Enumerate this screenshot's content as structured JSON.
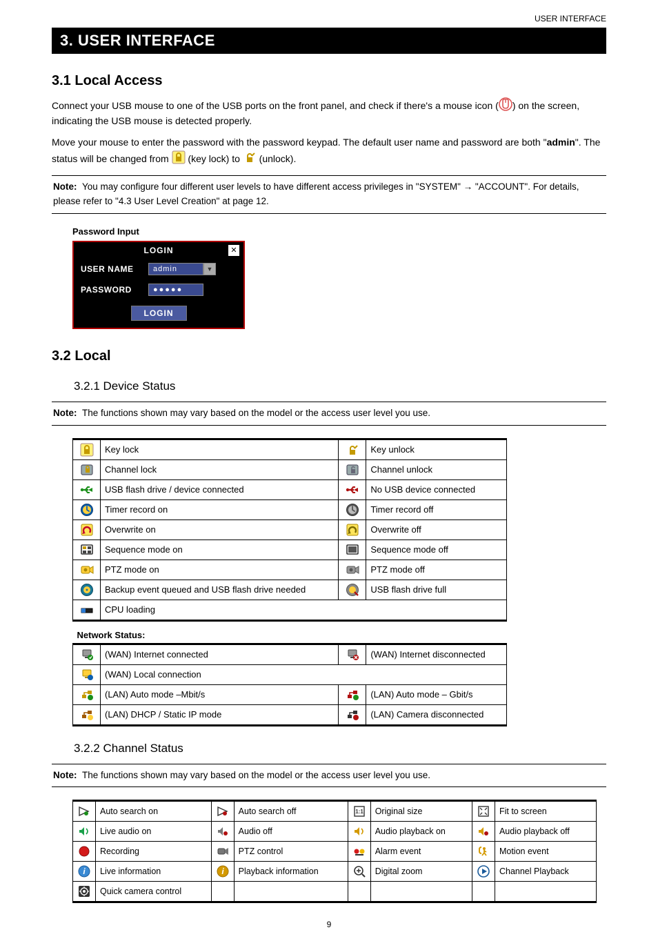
{
  "header_right": "USER INTERFACE",
  "chapter_title": "3. USER INTERFACE",
  "s31": {
    "title": "3.1 Local Access",
    "p1a": "Connect your USB mouse to one of the USB ports on the front panel, and check if there's a mouse icon (",
    "p1b": ") on the screen, indicating the USB mouse is detected properly.",
    "p2a": "Move your mouse to enter the password with the password keypad. The default user name and password are both \"",
    "p2_admin": "admin",
    "p2b": "\". The status will be changed from ",
    "p2c": " (key lock) to ",
    "p2d": " (unlock).",
    "note_label": "Note:",
    "note_text": "  You may configure four different user levels to have different access privileges in \"SYSTEM\" → \"ACCOUNT\". For details, please refer to \"4.3 User Level Creation\" at page 12."
  },
  "login": {
    "heading": "Password Input",
    "title": "LOGIN",
    "close": "✕",
    "username_label": "USER NAME",
    "username_value": "admin",
    "password_label": "PASSWORD",
    "password_value": "●●●●●",
    "button": "LOGIN"
  },
  "s32": {
    "title": "3.2 Local",
    "sub1": "3.2.1 Device Status",
    "note_label": "Note:",
    "note_text": "  The functions shown may vary based on the model or the access user level you use."
  },
  "device_status": {
    "rows": [
      [
        "Key lock",
        "Key unlock"
      ],
      [
        "Channel lock",
        "Channel unlock"
      ],
      [
        "USB flash drive / device connected",
        "No USB device connected"
      ],
      [
        "Timer record on",
        "Timer record off"
      ],
      [
        "Overwrite on",
        "Overwrite off"
      ],
      [
        "Sequence mode on",
        "Sequence mode off"
      ],
      [
        "PTZ mode on",
        "PTZ mode off"
      ],
      [
        "Backup event queued and USB flash drive needed",
        "USB flash drive full"
      ]
    ],
    "cpu_row": "CPU loading",
    "network_header": "Network Status:",
    "net_rows": [
      [
        "(WAN) Internet connected",
        "(WAN) Internet disconnected"
      ],
      [
        "(WAN) Local connection",
        ""
      ],
      [
        "(LAN) Auto mode –Mbit/s",
        "(LAN) Auto mode – Gbit/s"
      ],
      [
        "(LAN) DHCP / Static IP mode",
        "(LAN) Camera disconnected"
      ]
    ]
  },
  "s322": {
    "title": "3.2.2 Channel Status",
    "note_label": "Note:",
    "note_text": "  The functions shown may vary based on the model or the access user level you use."
  },
  "channel_status": {
    "rows": [
      [
        "Auto search on",
        "Auto search off",
        "Original size",
        "Fit to screen"
      ],
      [
        "Live audio on",
        "Audio off",
        "Audio playback on",
        "Audio playback off"
      ],
      [
        "Recording",
        "PTZ control",
        "Alarm event",
        "Motion event"
      ],
      [
        "Live information",
        "Playback information",
        "Digital zoom",
        "Channel Playback"
      ],
      [
        "Quick camera control",
        "",
        "",
        ""
      ]
    ]
  },
  "page_number": "9"
}
